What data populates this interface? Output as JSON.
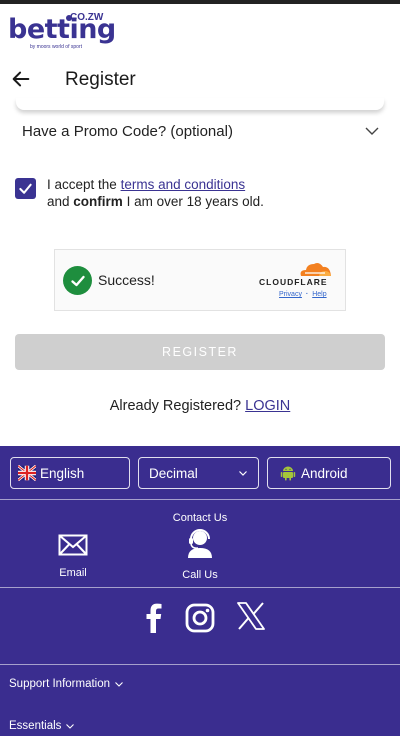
{
  "brand": {
    "name": "betting",
    "tld": "CO.ZW",
    "tagline": "by moors world of sport"
  },
  "header": {
    "title": "Register"
  },
  "form": {
    "promo_label": "Have a Promo Code? (optional)",
    "terms_prefix": "I accept the",
    "terms_link": "terms and conditions",
    "terms_line2_a": "and",
    "terms_confirm": "confirm",
    "terms_line2_b": "I am over 18 years old.",
    "terms_checked": true
  },
  "captcha": {
    "status": "Success!",
    "provider": "CLOUDFLARE",
    "privacy": "Privacy",
    "sep": "·",
    "help": "Help"
  },
  "actions": {
    "register_label": "REGISTER",
    "already_text": "Already Registered?",
    "login_link": "LOGIN"
  },
  "footer": {
    "language": "English",
    "odds_format": "Decimal",
    "app": "Android",
    "contact_title": "Contact Us",
    "email_label": "Email",
    "call_label": "Call Us",
    "support_link": "Support Information",
    "essentials_link": "Essentials"
  },
  "colors": {
    "brand": "#3a3392",
    "footer_bg": "#3a2d8f",
    "success": "#1e8e3e",
    "cloudflare": "#f38020",
    "button_disabled": "#cfcfcf"
  },
  "icons": [
    "back-arrow-icon",
    "chevron-down-icon",
    "checkmark-icon",
    "cloudflare-icon",
    "uk-flag-icon",
    "android-icon",
    "envelope-icon",
    "headset-icon",
    "facebook-icon",
    "instagram-icon",
    "x-icon"
  ]
}
